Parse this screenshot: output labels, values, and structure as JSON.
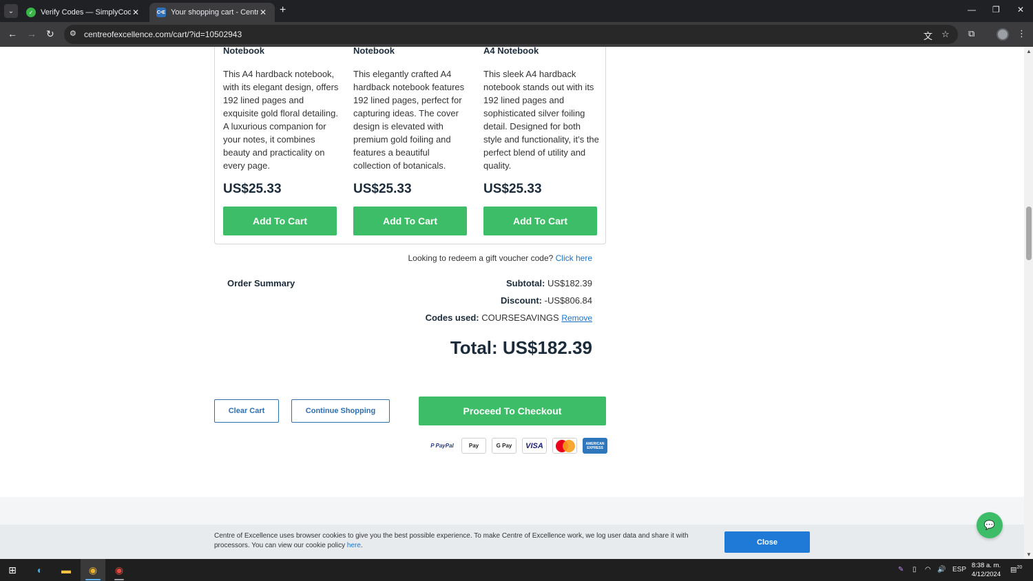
{
  "browser": {
    "tabs": [
      {
        "title": "Verify Codes — SimplyCodes",
        "active": false
      },
      {
        "title": "Your shopping cart - Centre of",
        "active": true
      }
    ],
    "tab2_favicon_text": "C•E",
    "url": "centreofexcellence.com/cart/?id=10502943"
  },
  "products": [
    {
      "name": "Notebook",
      "description": "This A4 hardback notebook, with its elegant design, offers 192 lined pages and exquisite gold floral detailing. A luxurious companion for your notes, it combines beauty and practicality on every page.",
      "price": "US$25.33",
      "button": "Add To Cart"
    },
    {
      "name": "Notebook",
      "description": "This elegantly crafted A4 hardback notebook features 192 lined pages, perfect for capturing ideas. The cover design is elevated with premium gold foiling and features a beautiful collection of botanicals.",
      "price": "US$25.33",
      "button": "Add To Cart"
    },
    {
      "name": "A4 Notebook",
      "description": "This sleek A4 hardback notebook stands out with its 192 lined pages and sophisticated silver foiling detail. Designed for both style and functionality, it’s the perfect blend of utility and quality.",
      "price": "US$25.33",
      "button": "Add To Cart"
    }
  ],
  "voucher": {
    "text": "Looking to redeem a gift voucher code?",
    "link": "Click here"
  },
  "summary": {
    "label": "Order Summary",
    "subtotal_label": "Subtotal:",
    "subtotal_value": "US$182.39",
    "discount_label": "Discount:",
    "discount_value": "-US$806.84",
    "codes_label": "Codes used:",
    "codes_value": "COURSESAVINGS",
    "remove_label": "Remove",
    "total": "Total: US$182.39"
  },
  "actions": {
    "clear_cart": "Clear Cart",
    "continue_shopping": "Continue Shopping",
    "checkout": "Proceed To Checkout"
  },
  "payment_methods": [
    {
      "name": "PayPal",
      "label": "P PayPal"
    },
    {
      "name": "Apple Pay",
      "label": " Pay"
    },
    {
      "name": "Google Pay",
      "label": "G Pay"
    },
    {
      "name": "Visa",
      "label": "VISA"
    },
    {
      "name": "Mastercard",
      "label": ""
    },
    {
      "name": "American Express",
      "label": "AMERICAN EXPRESS"
    }
  ],
  "cookie": {
    "text": "Centre of Excellence uses browser cookies to give you the best possible experience. To make Centre of Excellence work, we log user data and share it with processors. You can view our cookie policy",
    "link": "here",
    "close": "Close"
  },
  "taskbar": {
    "lang": "ESP",
    "time": "8:38 a. m.",
    "date": "4/12/2024",
    "notifications": "20"
  },
  "colors": {
    "green": "#3dbd67",
    "blue_link": "#1a73c8",
    "dark_text": "#1c2b3a"
  }
}
